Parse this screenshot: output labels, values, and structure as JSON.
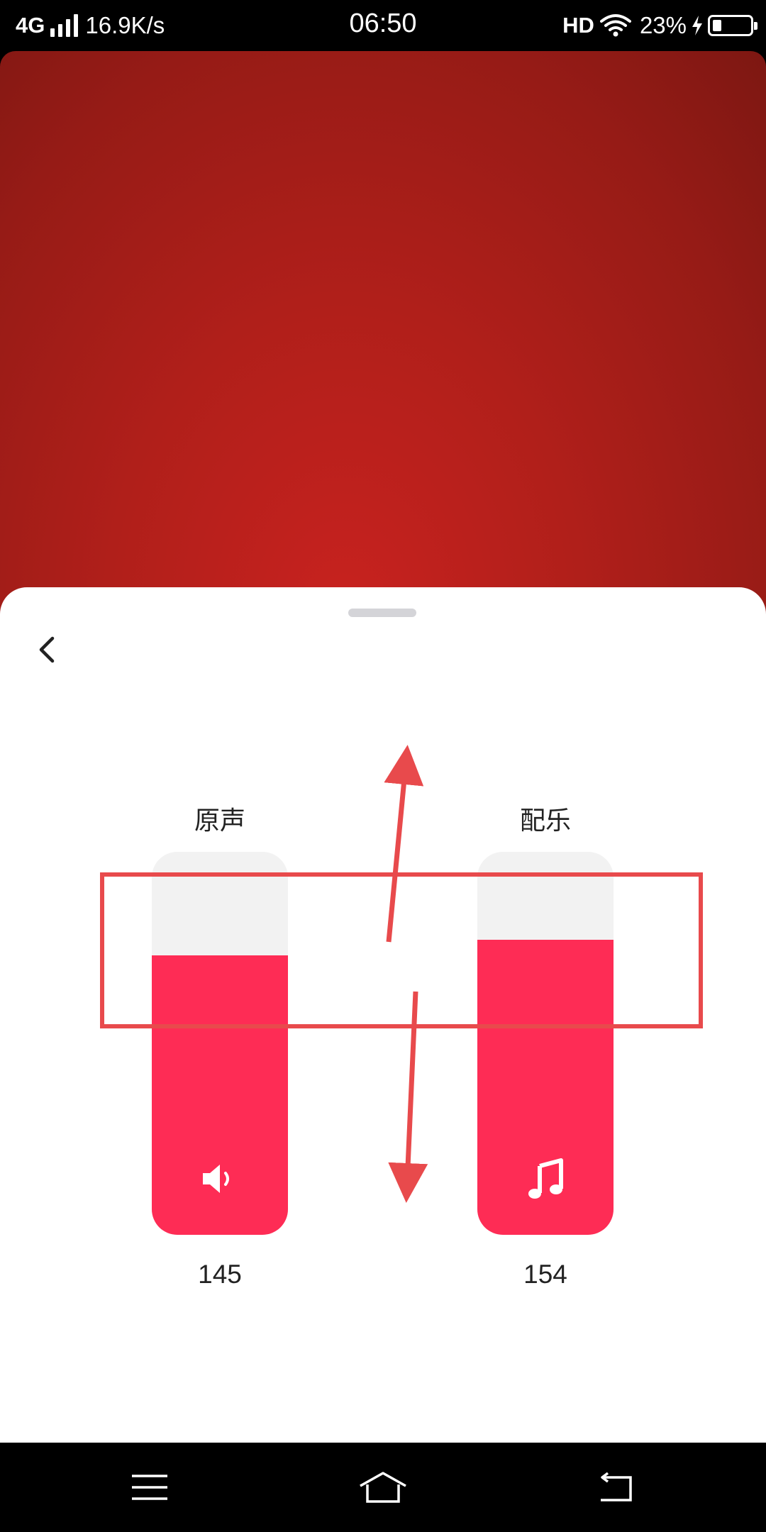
{
  "status_bar": {
    "network": "4G",
    "speed": "16.9K/s",
    "time": "06:50",
    "hd": "HD",
    "battery_percent": "23%",
    "battery_level": 0.23,
    "icons": [
      "signal-icon",
      "wifi-icon",
      "charging-icon",
      "battery-icon"
    ]
  },
  "sheet": {
    "back_icon": "chevron-left-icon",
    "sliders": [
      {
        "label": "原声",
        "value": "145",
        "level": 0.73,
        "icon": "speaker-icon"
      },
      {
        "label": "配乐",
        "value": "154",
        "level": 0.77,
        "icon": "music-note-icon"
      }
    ]
  },
  "colors": {
    "accent": "#fe2c55",
    "track": "#f2f2f2",
    "annotation": "#e84a4c",
    "preview": "#b01f1a"
  },
  "nav_bar": {
    "icons": [
      "menu-icon",
      "home-icon",
      "back-icon"
    ]
  }
}
